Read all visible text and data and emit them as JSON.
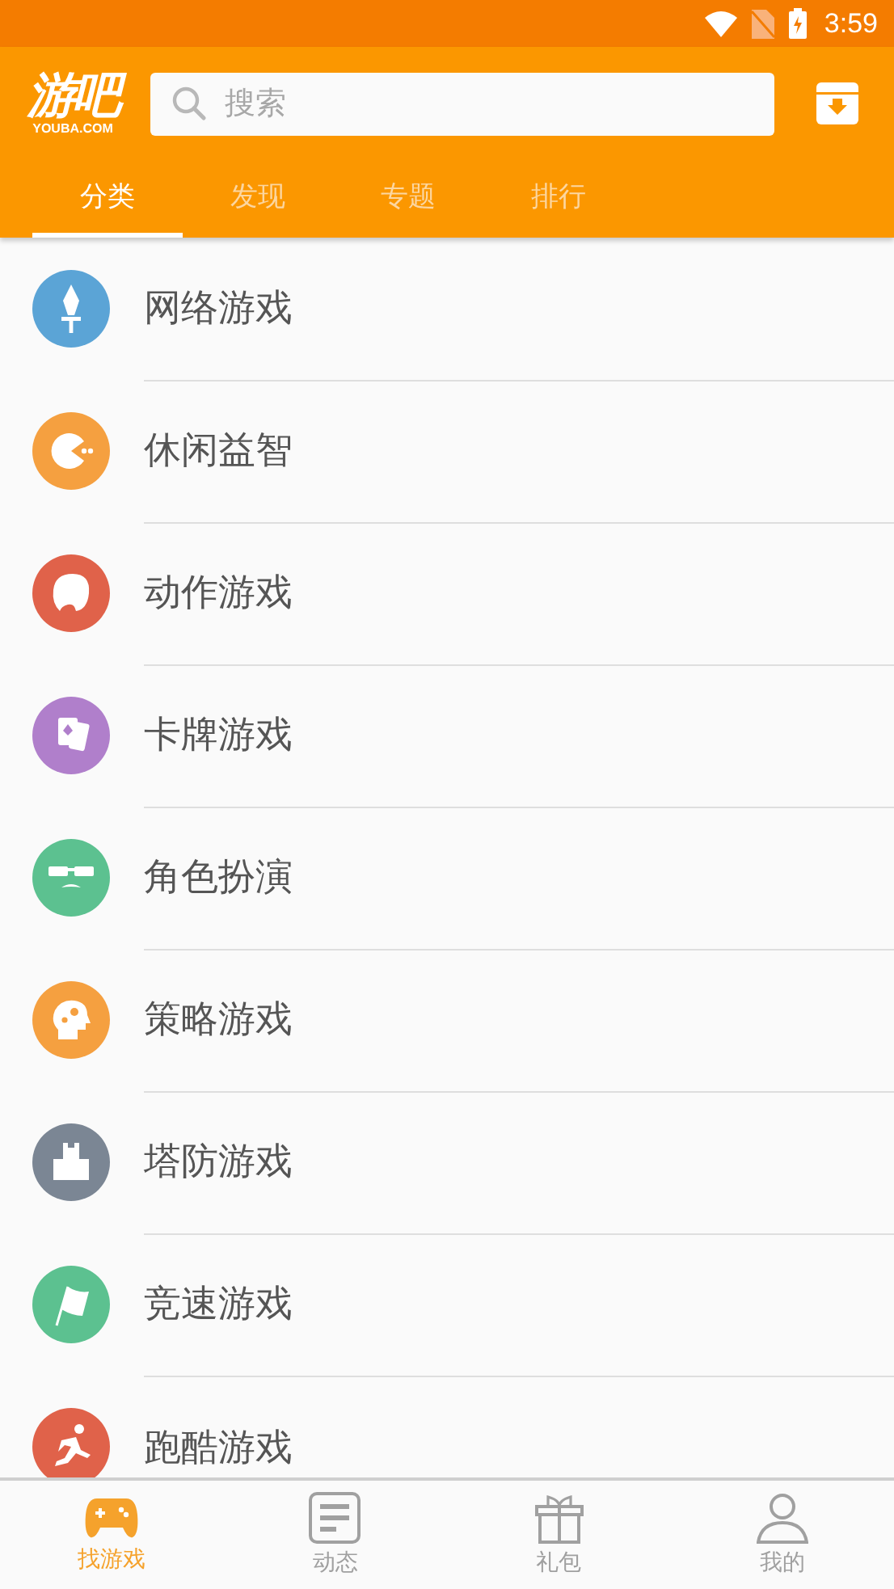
{
  "status_bar": {
    "time": "3:59"
  },
  "header": {
    "logo": "游吧",
    "logo_sub": "YOUBA.COM",
    "search": {
      "placeholder": "搜索"
    }
  },
  "tabs": [
    {
      "label": "分类",
      "selected": true
    },
    {
      "label": "发现",
      "selected": false
    },
    {
      "label": "专题",
      "selected": false
    },
    {
      "label": "排行",
      "selected": false
    }
  ],
  "categories": [
    {
      "label": "网络游戏",
      "color": "#5ba4d6"
    },
    {
      "label": "休闲益智",
      "color": "#f5a040"
    },
    {
      "label": "动作游戏",
      "color": "#e0624a"
    },
    {
      "label": "卡牌游戏",
      "color": "#b07fcb"
    },
    {
      "label": "角色扮演",
      "color": "#5cc190"
    },
    {
      "label": "策略游戏",
      "color": "#f5a040"
    },
    {
      "label": "塔防游戏",
      "color": "#7b8694"
    },
    {
      "label": "竞速游戏",
      "color": "#5cc190"
    },
    {
      "label": "跑酷游戏",
      "color": "#e0624a"
    }
  ],
  "bottom_nav": [
    {
      "label": "找游戏",
      "selected": true
    },
    {
      "label": "动态",
      "selected": false
    },
    {
      "label": "礼包",
      "selected": false
    },
    {
      "label": "我的",
      "selected": false
    }
  ]
}
